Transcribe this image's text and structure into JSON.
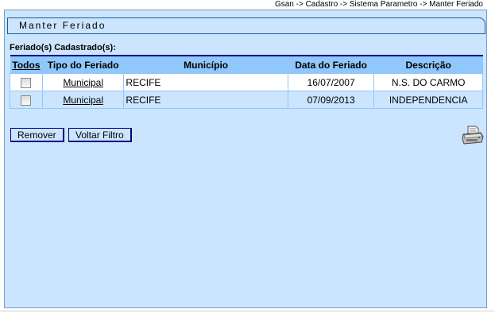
{
  "breadcrumb": "Gsan -> Cadastro -> Sistema Parametro -> Manter Feriado",
  "page_title": "Manter Feriado",
  "list_title": "Feriado(s) Cadastrado(s):",
  "table": {
    "headers": {
      "todos": "Todos",
      "tipo": "Tipo do Feriado",
      "municipio": "Município",
      "data": "Data do Feriado",
      "descricao": "Descrição"
    },
    "rows": [
      {
        "tipo": "Municipal",
        "municipio": "RECIFE",
        "data": "16/07/2007",
        "descricao": "N.S. DO CARMO"
      },
      {
        "tipo": "Municipal",
        "municipio": "RECIFE",
        "data": "07/09/2013",
        "descricao": "INDEPENDENCIA"
      }
    ]
  },
  "buttons": {
    "remover": "Remover",
    "voltar_filtro": "Voltar Filtro"
  },
  "icons": {
    "printer": "printer-icon"
  },
  "colors": {
    "panel_bg": "#cbe5fe",
    "header_bg": "#90c7fc",
    "border": "#000080"
  }
}
